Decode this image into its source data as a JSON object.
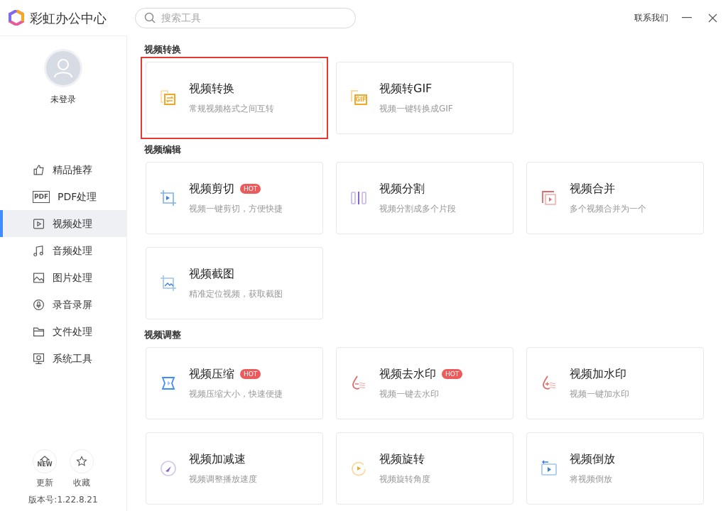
{
  "app": {
    "title": "彩虹办公中心"
  },
  "search": {
    "placeholder": "搜索工具"
  },
  "header_links": [
    "联系我们"
  ],
  "user": {
    "name": "未登录"
  },
  "sidebar": {
    "items": [
      {
        "label": "精品推荐",
        "selected": false
      },
      {
        "label": "PDF处理",
        "selected": false,
        "icon_text": "PDF"
      },
      {
        "label": "视频处理",
        "selected": true
      },
      {
        "label": "音频处理",
        "selected": false
      },
      {
        "label": "图片处理",
        "selected": false
      },
      {
        "label": "录音录屏",
        "selected": false
      },
      {
        "label": "文件处理",
        "selected": false
      },
      {
        "label": "系统工具",
        "selected": false
      }
    ]
  },
  "footer": {
    "buttons": [
      {
        "label": "更新",
        "icon_text": "NEW"
      },
      {
        "label": "收藏"
      }
    ],
    "version": "版本号:1.22.8.21"
  },
  "sections": [
    {
      "title": "视频转换",
      "tools": [
        {
          "name": "视频转换",
          "desc": "常规视频格式之间互转",
          "highlighted": true
        },
        {
          "name": "视频转GIF",
          "desc": "视频一键转换成GIF",
          "highlighted": false,
          "icon_text": "GIF"
        }
      ]
    },
    {
      "title": "视频编辑",
      "tools": [
        {
          "name": "视频剪切",
          "desc": "视频一键剪切，方便快捷",
          "badge": "HOT",
          "highlighted": false
        },
        {
          "name": "视频分割",
          "desc": "视频分割成多个片段",
          "highlighted": false
        },
        {
          "name": "视频合并",
          "desc": "多个视频合并为一个",
          "highlighted": false
        },
        {
          "name": "视频截图",
          "desc": "精准定位视频，获取截图",
          "highlighted": false
        }
      ]
    },
    {
      "title": "视频调整",
      "tools": [
        {
          "name": "视频压缩",
          "desc": "视频压缩大小，快速便捷",
          "badge": "HOT",
          "highlighted": false
        },
        {
          "name": "视频去水印",
          "desc": "视频一键去水印",
          "badge": "HOT",
          "highlighted": false
        },
        {
          "name": "视频加水印",
          "desc": "视频一键加水印",
          "highlighted": false
        },
        {
          "name": "视频加减速",
          "desc": "视频调整播放速度",
          "highlighted": false
        },
        {
          "name": "视频旋转",
          "desc": "视频旋转角度",
          "highlighted": false
        },
        {
          "name": "视频倒放",
          "desc": "将视频倒放",
          "highlighted": false
        }
      ]
    }
  ]
}
